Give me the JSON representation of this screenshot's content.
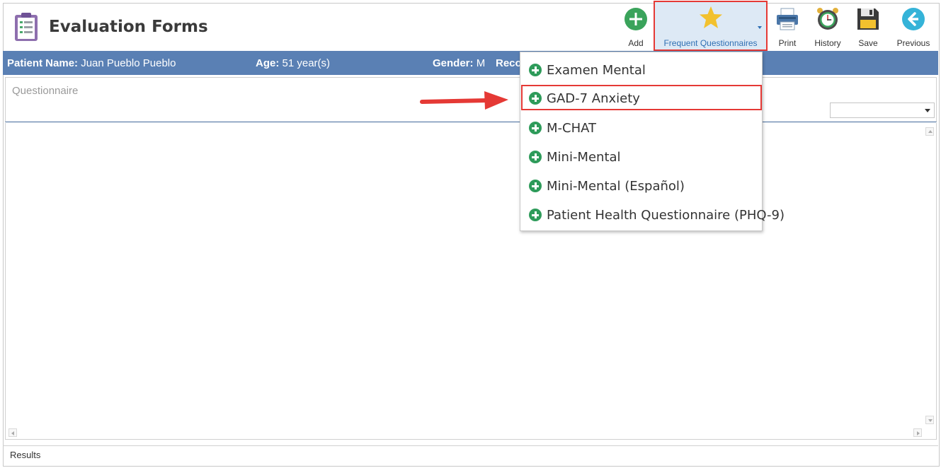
{
  "header": {
    "title": "Evaluation Forms",
    "app_icon": "clipboard-list-icon"
  },
  "toolbar": {
    "add": {
      "label": "Add",
      "icon": "plus-circle-icon",
      "color": "#3aa35b"
    },
    "frequent": {
      "label": "Frequent Questionnaires",
      "icon": "star-icon",
      "color": "#f2c12e"
    },
    "print": {
      "label": "Print",
      "icon": "printer-icon"
    },
    "history": {
      "label": "History",
      "icon": "alarm-clock-icon"
    },
    "save": {
      "label": "Save",
      "icon": "floppy-disk-icon"
    },
    "previous": {
      "label": "Previous",
      "icon": "back-arrow-icon",
      "color": "#35b3d8"
    }
  },
  "patient": {
    "name_label": "Patient Name:",
    "name": "Juan Pueblo Pueblo",
    "age_label": "Age:",
    "age": "51 year(s)",
    "gender_label": "Gender:",
    "gender": "M",
    "record_label_partial": "Reco"
  },
  "questionnaire": {
    "label": "Questionnaire",
    "select_value": ""
  },
  "frequent_menu": {
    "items": [
      {
        "label": "Examen Mental",
        "icon": "plus-circle-icon"
      },
      {
        "label": "GAD-7 Anxiety",
        "icon": "plus-circle-icon",
        "highlighted": true
      },
      {
        "label": "M-CHAT",
        "icon": "plus-circle-icon"
      },
      {
        "label": "Mini-Mental",
        "icon": "plus-circle-icon"
      },
      {
        "label": "Mini-Mental (Español)",
        "icon": "plus-circle-icon"
      },
      {
        "label": "Patient Health Questionnaire (PHQ-9)",
        "icon": "plus-circle-icon"
      }
    ]
  },
  "results": {
    "label": "Results"
  },
  "colors": {
    "patient_bar": "#5a80b4",
    "highlight_border": "#e53935",
    "annotation_arrow": "#e53935",
    "menu_plus": "#2e9b5a"
  }
}
